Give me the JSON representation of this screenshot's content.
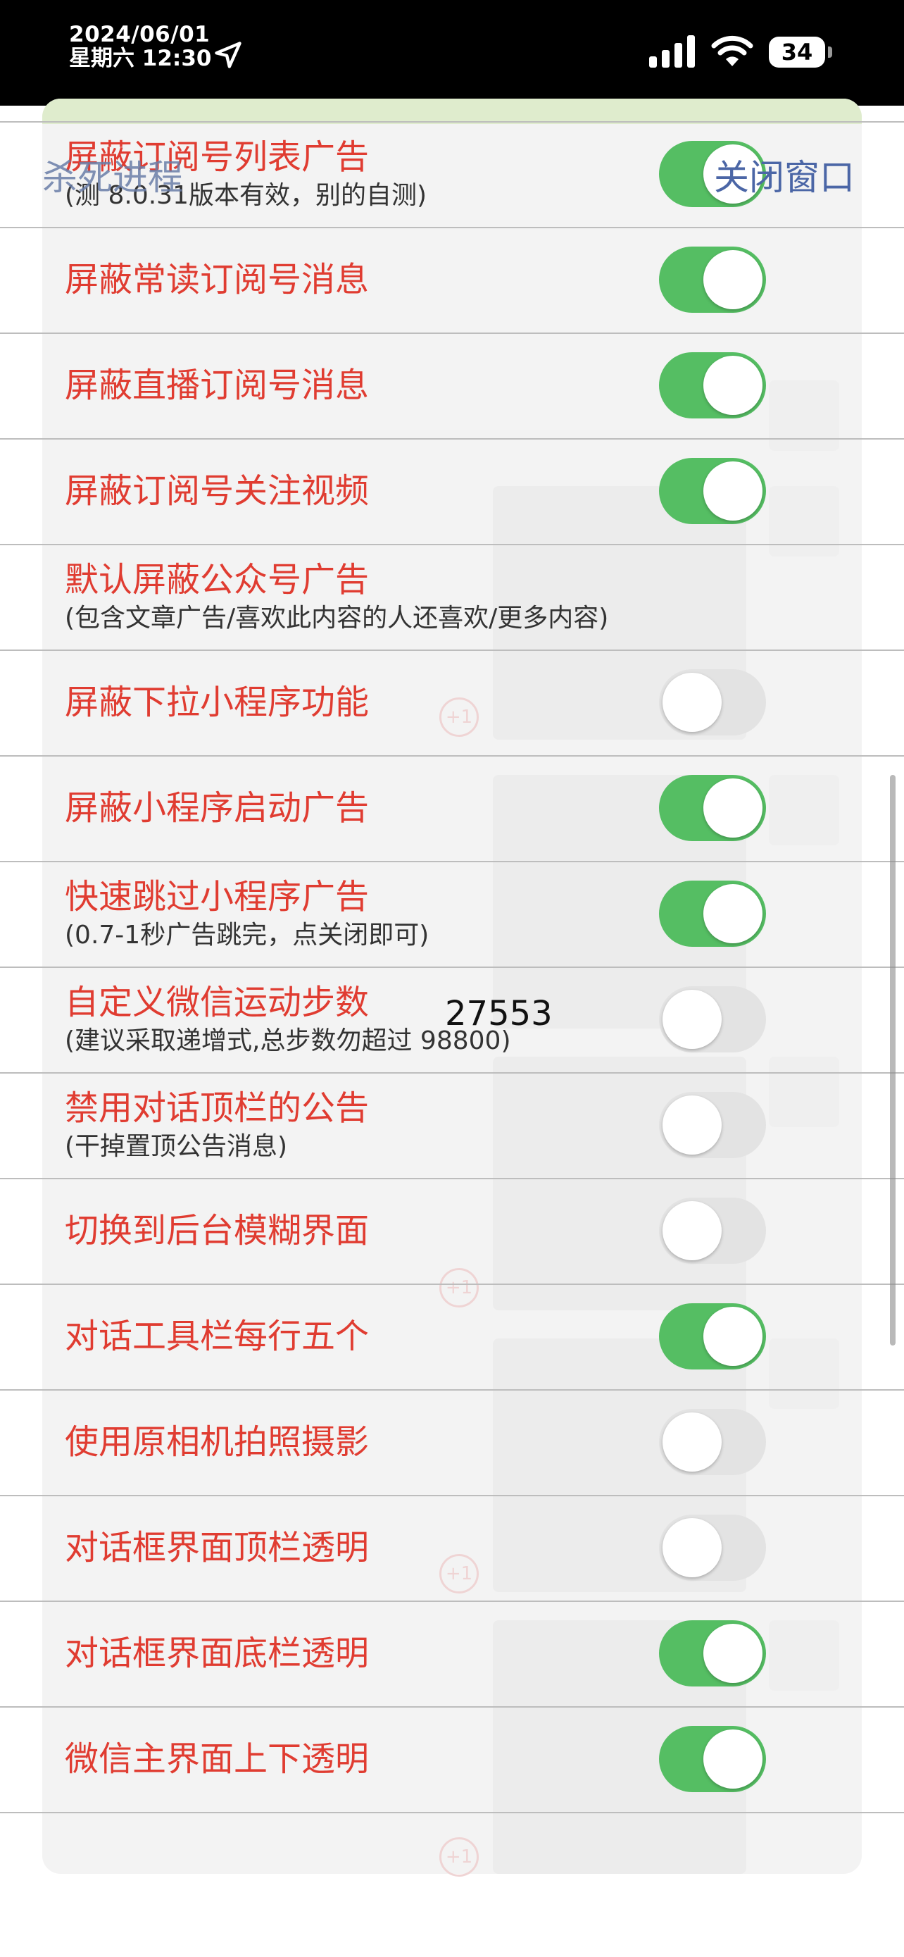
{
  "status_bar": {
    "date": "2024/06/01",
    "time": "星期六 12:30",
    "battery": "34",
    "icons": [
      "location-arrow-icon",
      "cellular-signal-icon",
      "wifi-icon",
      "battery-icon"
    ]
  },
  "overlay": {
    "kill_label": "杀死进程",
    "close_label": "关闭窗口"
  },
  "settings": [
    {
      "title": "屏蔽订阅号列表广告",
      "sub": "(测 8.0.31版本有效，别的自测)",
      "on": true
    },
    {
      "title": "屏蔽常读订阅号消息",
      "sub": "",
      "on": true
    },
    {
      "title": "屏蔽直播订阅号消息",
      "sub": "",
      "on": true
    },
    {
      "title": "屏蔽订阅号关注视频",
      "sub": "",
      "on": true
    },
    {
      "title": "默认屏蔽公众号广告",
      "sub": "(包含文章广告/喜欢此内容的人还喜欢/更多内容)",
      "on": null
    },
    {
      "title": "屏蔽下拉小程序功能",
      "sub": "",
      "on": false
    },
    {
      "title": "屏蔽小程序启动广告",
      "sub": "",
      "on": true
    },
    {
      "title": "快速跳过小程序广告",
      "sub": "(0.7-1秒广告跳完，点关闭即可)",
      "on": true
    },
    {
      "title": "自定义微信运动步数",
      "sub": "(建议采取递增式,总步数勿超过 98800)",
      "on": false,
      "value": "27553"
    },
    {
      "title": "禁用对话顶栏的公告",
      "sub": "(干掉置顶公告消息)",
      "on": false
    },
    {
      "title": "切换到后台模糊界面",
      "sub": "",
      "on": false
    },
    {
      "title": "对话工具栏每行五个",
      "sub": "",
      "on": true
    },
    {
      "title": "使用原相机拍照摄影",
      "sub": "",
      "on": false
    },
    {
      "title": "对话框界面顶栏透明",
      "sub": "",
      "on": false
    },
    {
      "title": "对话框界面底栏透明",
      "sub": "",
      "on": true
    },
    {
      "title": "微信主界面上下透明",
      "sub": "",
      "on": true
    }
  ],
  "colors": {
    "title_red": "#e03c31",
    "toggle_on": "#55be63",
    "toggle_off": "#e3e3e3",
    "link_blue": "#4b66a6"
  }
}
